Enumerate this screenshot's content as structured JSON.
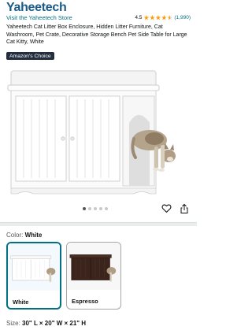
{
  "header": {
    "brand": "Yaheetech",
    "store_link": "Visit the Yaheetech Store",
    "rating_value": "4.5",
    "rating_count": "(1,990)",
    "rating_stars": 4.5
  },
  "product": {
    "title": "Yaheetech Cat Litter Box Enclosure, Hidden Litter Furniture, Cat Washroom, Pet Crate, Decorative Storage Bench Pet Side Table for Large Cat Kitty, White",
    "badge": "Amazon's Choice",
    "image_icon": "cat-litter-box-enclosure-image"
  },
  "gallery": {
    "dot_count": 5,
    "active_index": 0,
    "heart_icon": "heart-icon",
    "share_icon": "share-icon"
  },
  "variants": {
    "color_label": "Color:",
    "selected_color": "White",
    "options": [
      {
        "name": "White",
        "selected": true
      },
      {
        "name": "Espresso",
        "selected": false
      }
    ]
  },
  "size": {
    "label": "Size:",
    "value": "30\" L × 20\" W × 21\" H"
  },
  "colors": {
    "brand": "#1a5a86",
    "link": "#007185",
    "badge_bg": "#232f3e",
    "star": "#ff9900",
    "selected_border": "#007185",
    "espresso": "#3b241c"
  }
}
